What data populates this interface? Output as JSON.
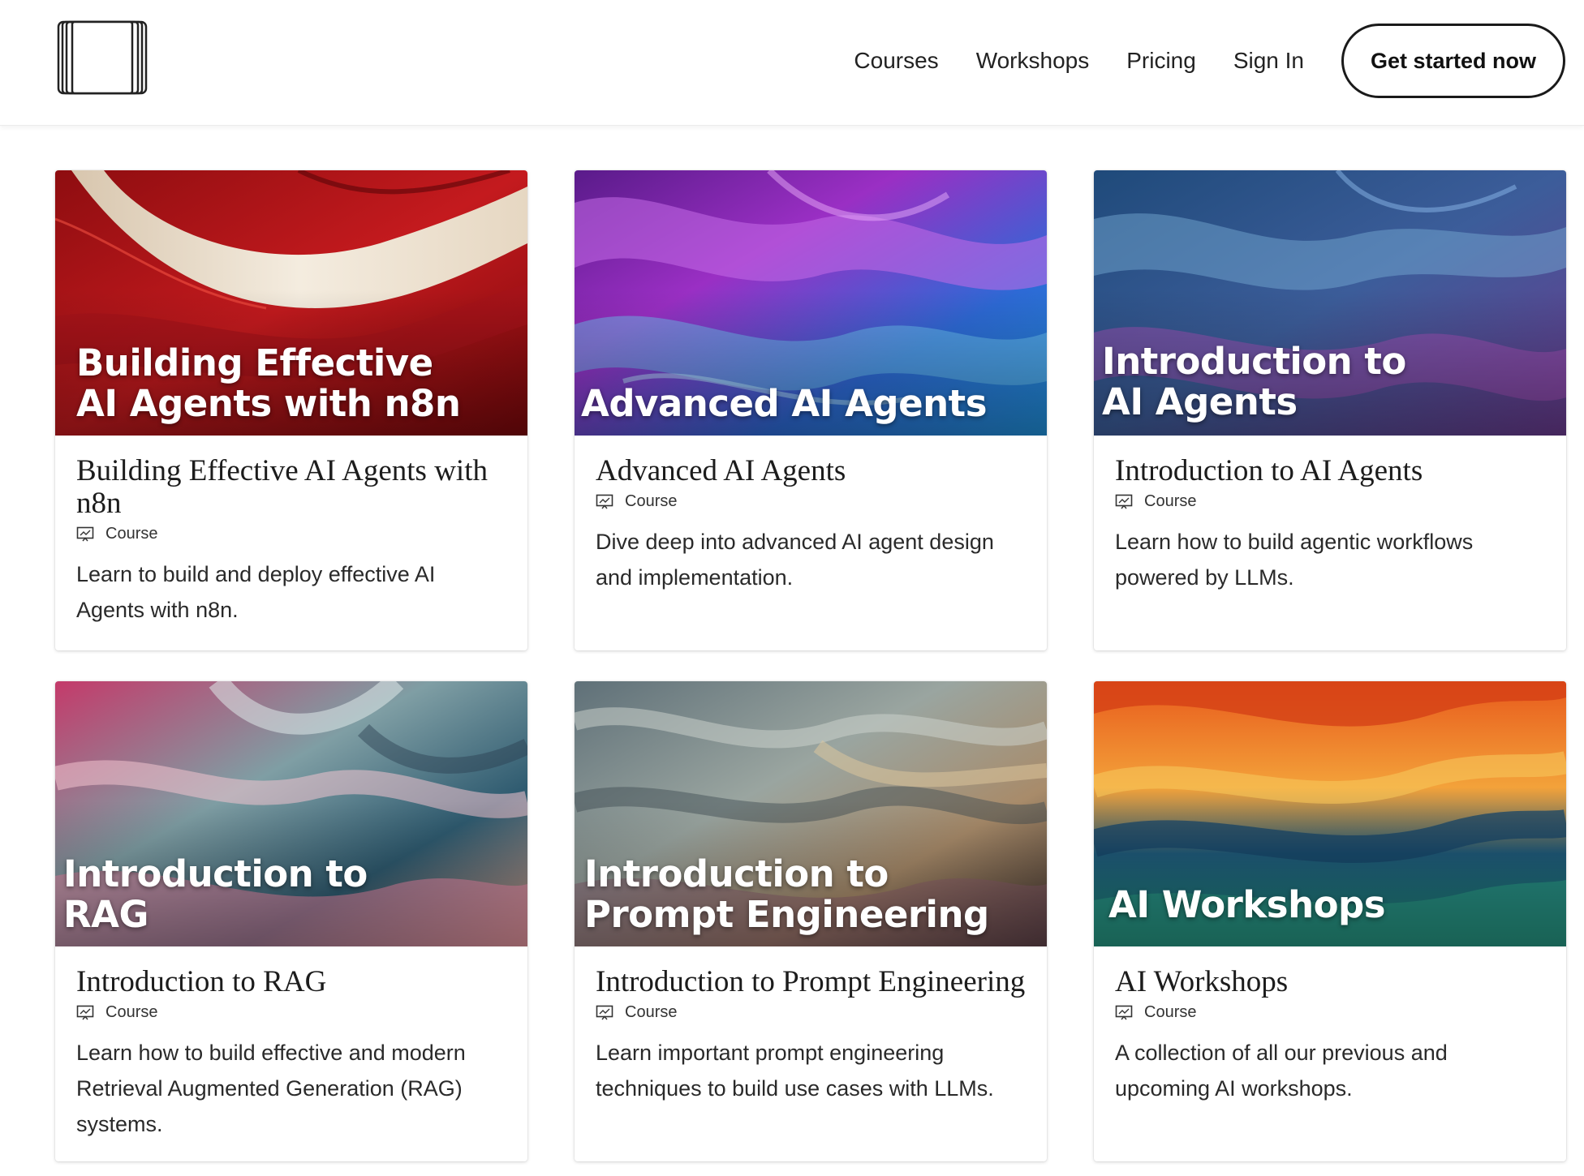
{
  "header": {
    "logo_icon": "book-stack-icon",
    "nav": {
      "courses": "Courses",
      "workshops": "Workshops",
      "pricing": "Pricing",
      "sign_in": "Sign In"
    },
    "cta_label": "Get started now"
  },
  "cards": [
    {
      "banner_title_line1": "Building Effective",
      "banner_title_line2": "AI Agents with n8n",
      "title": "Building Effective AI Agents with n8n",
      "type": "Course",
      "description": "Learn to build and deploy effective AI Agents with n8n.",
      "palette": "red-cream"
    },
    {
      "banner_title_line1": "Advanced AI Agents",
      "banner_title_line2": "",
      "title": "Advanced AI Agents",
      "type": "Course",
      "description": "Dive deep into advanced AI agent design and implementation.",
      "palette": "purple-blue"
    },
    {
      "banner_title_line1": "Introduction to",
      "banner_title_line2": "AI Agents",
      "title": "Introduction to AI Agents",
      "type": "Course",
      "description": "Learn how to build agentic workflows powered by LLMs.",
      "palette": "blue-purple"
    },
    {
      "banner_title_line1": "Introduction to",
      "banner_title_line2": "RAG",
      "title": "Introduction to RAG",
      "type": "Course",
      "description": "Learn how to build effective and modern Retrieval Augmented Generation (RAG) systems.",
      "palette": "pink-teal"
    },
    {
      "banner_title_line1": "Introduction to",
      "banner_title_line2": "Prompt Engineering",
      "title": "Introduction to Prompt Engineering",
      "type": "Course",
      "description": "Learn important prompt engineering techniques to build use cases with LLMs.",
      "palette": "grey-tan"
    },
    {
      "banner_title_line1": "AI Workshops",
      "banner_title_line2": "",
      "title": "AI Workshops",
      "type": "Course",
      "description": "A collection of all our previous and upcoming AI workshops.",
      "palette": "orange-teal"
    }
  ]
}
